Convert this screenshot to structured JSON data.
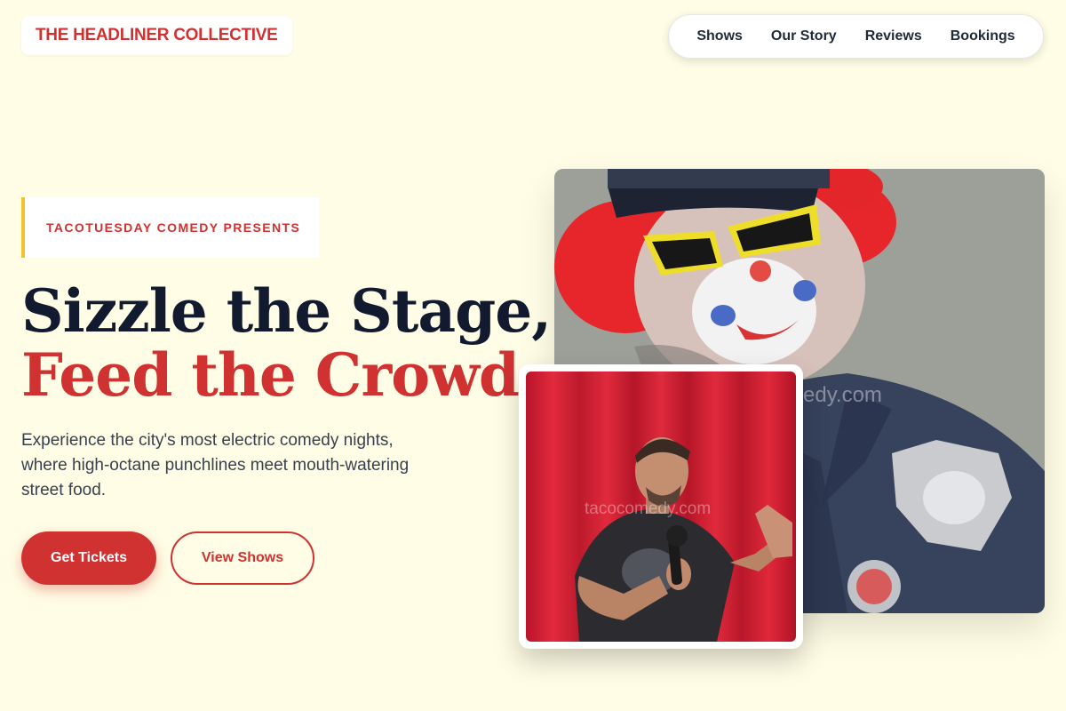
{
  "brand": {
    "name": "THE HEADLINER COLLECTIVE"
  },
  "nav": {
    "items": [
      "Shows",
      "Our Story",
      "Reviews",
      "Bookings"
    ]
  },
  "hero": {
    "kicker": "TACOTUESDAY COMEDY PRESENTS",
    "headline_line1": "Sizzle the Stage,",
    "headline_line2": "Feed the Crowd.",
    "description": "Experience the city's most electric comedy nights, where high-octane punchlines meet mouth-watering street food.",
    "primary_cta": "Get Tickets",
    "secondary_cta": "View Shows"
  },
  "images": {
    "main_watermark": "edy.com",
    "sub_watermark": "tacocomedy.com"
  },
  "colors": {
    "background": "#fffde5",
    "accent_red": "#d03131",
    "accent_yellow": "#f2c12e",
    "headline_dark": "#111a2e"
  }
}
